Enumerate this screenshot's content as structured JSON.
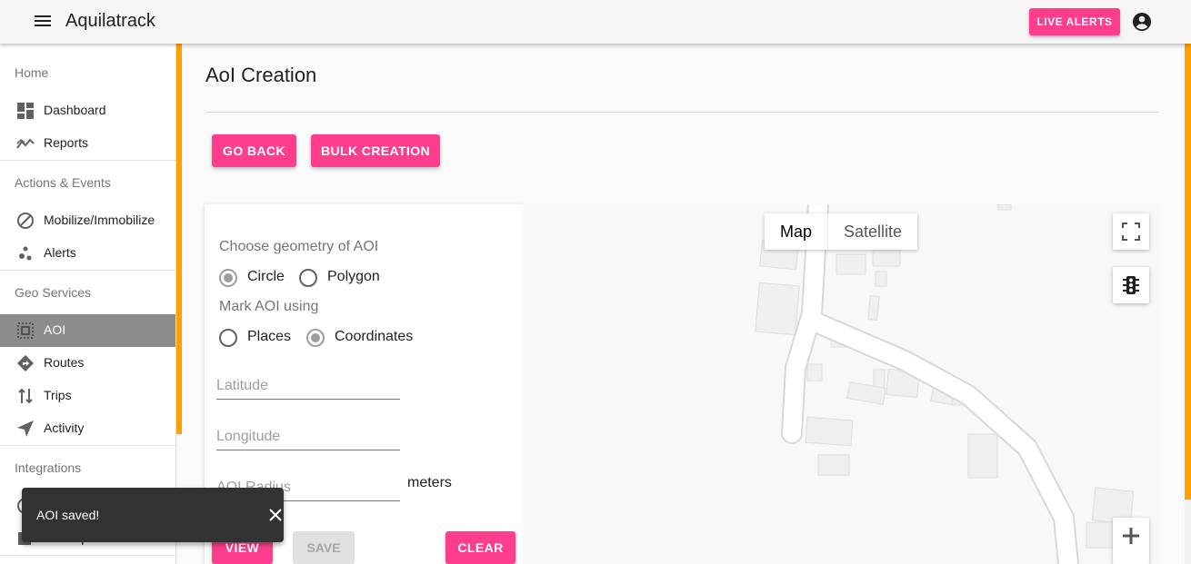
{
  "app": {
    "title": "Aquilatrack",
    "live_alerts_label": "LIVE ALERTS"
  },
  "colors": {
    "accent_pink": "#ff3d8d",
    "accent_orange": "#ffa000",
    "active_nav": "#8c8c8c"
  },
  "sidebar": {
    "sections": [
      {
        "header": "Home",
        "items": [
          {
            "label": "Dashboard",
            "icon": "dashboard-icon"
          },
          {
            "label": "Reports",
            "icon": "trending-icon"
          }
        ]
      },
      {
        "header": "Actions & Events",
        "items": [
          {
            "label": "Mobilize/Immobilize",
            "icon": "block-icon"
          },
          {
            "label": "Alerts",
            "icon": "bubbles-icon"
          }
        ]
      },
      {
        "header": "Geo Services",
        "items": [
          {
            "label": "AOI",
            "icon": "select-area-icon",
            "active": true
          },
          {
            "label": "Routes",
            "icon": "directions-icon"
          },
          {
            "label": "Trips",
            "icon": "swap-vertical-icon"
          },
          {
            "label": "Activity",
            "icon": "navigation-icon"
          }
        ]
      },
      {
        "header": "Integrations",
        "items": [
          {
            "label": "AH Report",
            "icon": "report-icon"
          }
        ]
      }
    ]
  },
  "main": {
    "page_title": "AoI Creation",
    "go_back_label": "GO BACK",
    "bulk_creation_label": "BULK CREATION"
  },
  "form": {
    "geometry_label": "Choose geometry of AOI",
    "geometry_options": [
      {
        "label": "Circle",
        "selected": true
      },
      {
        "label": "Polygon",
        "selected": false
      }
    ],
    "mark_label": "Mark AOI using",
    "mark_options": [
      {
        "label": "Places",
        "selected": false
      },
      {
        "label": "Coordinates",
        "selected": true
      }
    ],
    "latitude_placeholder": "Latitude",
    "longitude_placeholder": "Longitude",
    "radius_placeholder": "AOI Radius",
    "radius_unit": "meters",
    "view_label": "VIEW",
    "save_label": "SAVE",
    "clear_label": "CLEAR"
  },
  "map": {
    "map_label": "Map",
    "satellite_label": "Satellite",
    "selected_type": "Map"
  },
  "snackbar": {
    "message": "AOI saved!"
  }
}
